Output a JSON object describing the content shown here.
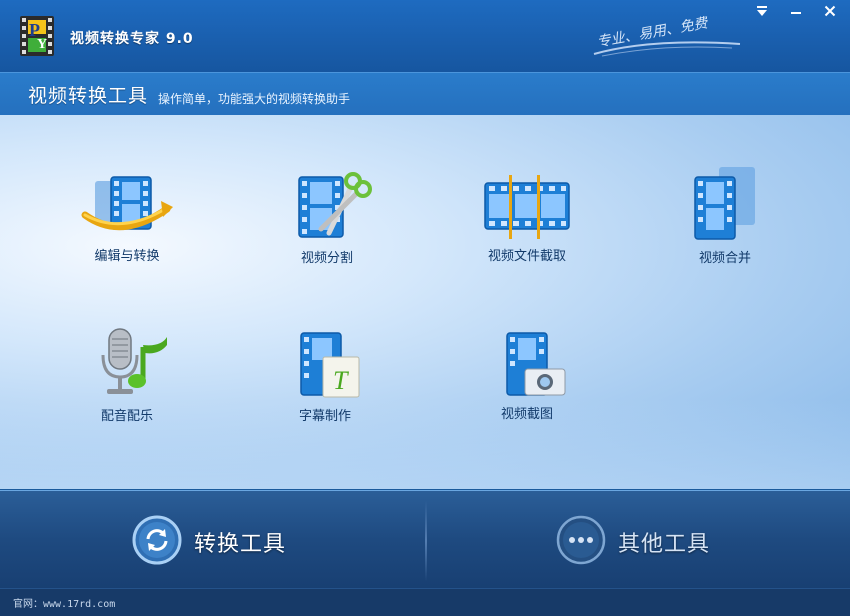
{
  "window": {
    "title": "视频转换专家 9.0",
    "slogan": "专业、易用、免费",
    "controls": {
      "menu_glyph": "▼",
      "minimize_glyph": "—",
      "close_glyph": "✕"
    }
  },
  "subheader": {
    "title": "视频转换工具",
    "description": "操作简单，功能强大的视频转换助手"
  },
  "tools": [
    {
      "label": "编辑与转换",
      "icon": "film-convert-icon"
    },
    {
      "label": "视频分割",
      "icon": "film-scissors-icon"
    },
    {
      "label": "视频文件截取",
      "icon": "film-clip-icon"
    },
    {
      "label": "视频合并",
      "icon": "film-merge-icon"
    },
    {
      "label": "配音配乐",
      "icon": "microphone-music-icon"
    },
    {
      "label": "字幕制作",
      "icon": "film-subtitle-icon"
    },
    {
      "label": "视频截图",
      "icon": "film-camera-icon"
    }
  ],
  "bottom_tabs": {
    "convert": {
      "label": "转换工具",
      "icon": "refresh-icon",
      "active": true
    },
    "other": {
      "label": "其他工具",
      "icon": "more-dots-icon",
      "active": false
    }
  },
  "status": {
    "site": "官网：www.17rd.com"
  },
  "colors": {
    "titlebar": "#1a5fae",
    "subheader": "#2a7ccb",
    "label_text": "#123a6a",
    "bottom_bar": "#1e4a80",
    "film_blue": "#1e7fd6"
  }
}
